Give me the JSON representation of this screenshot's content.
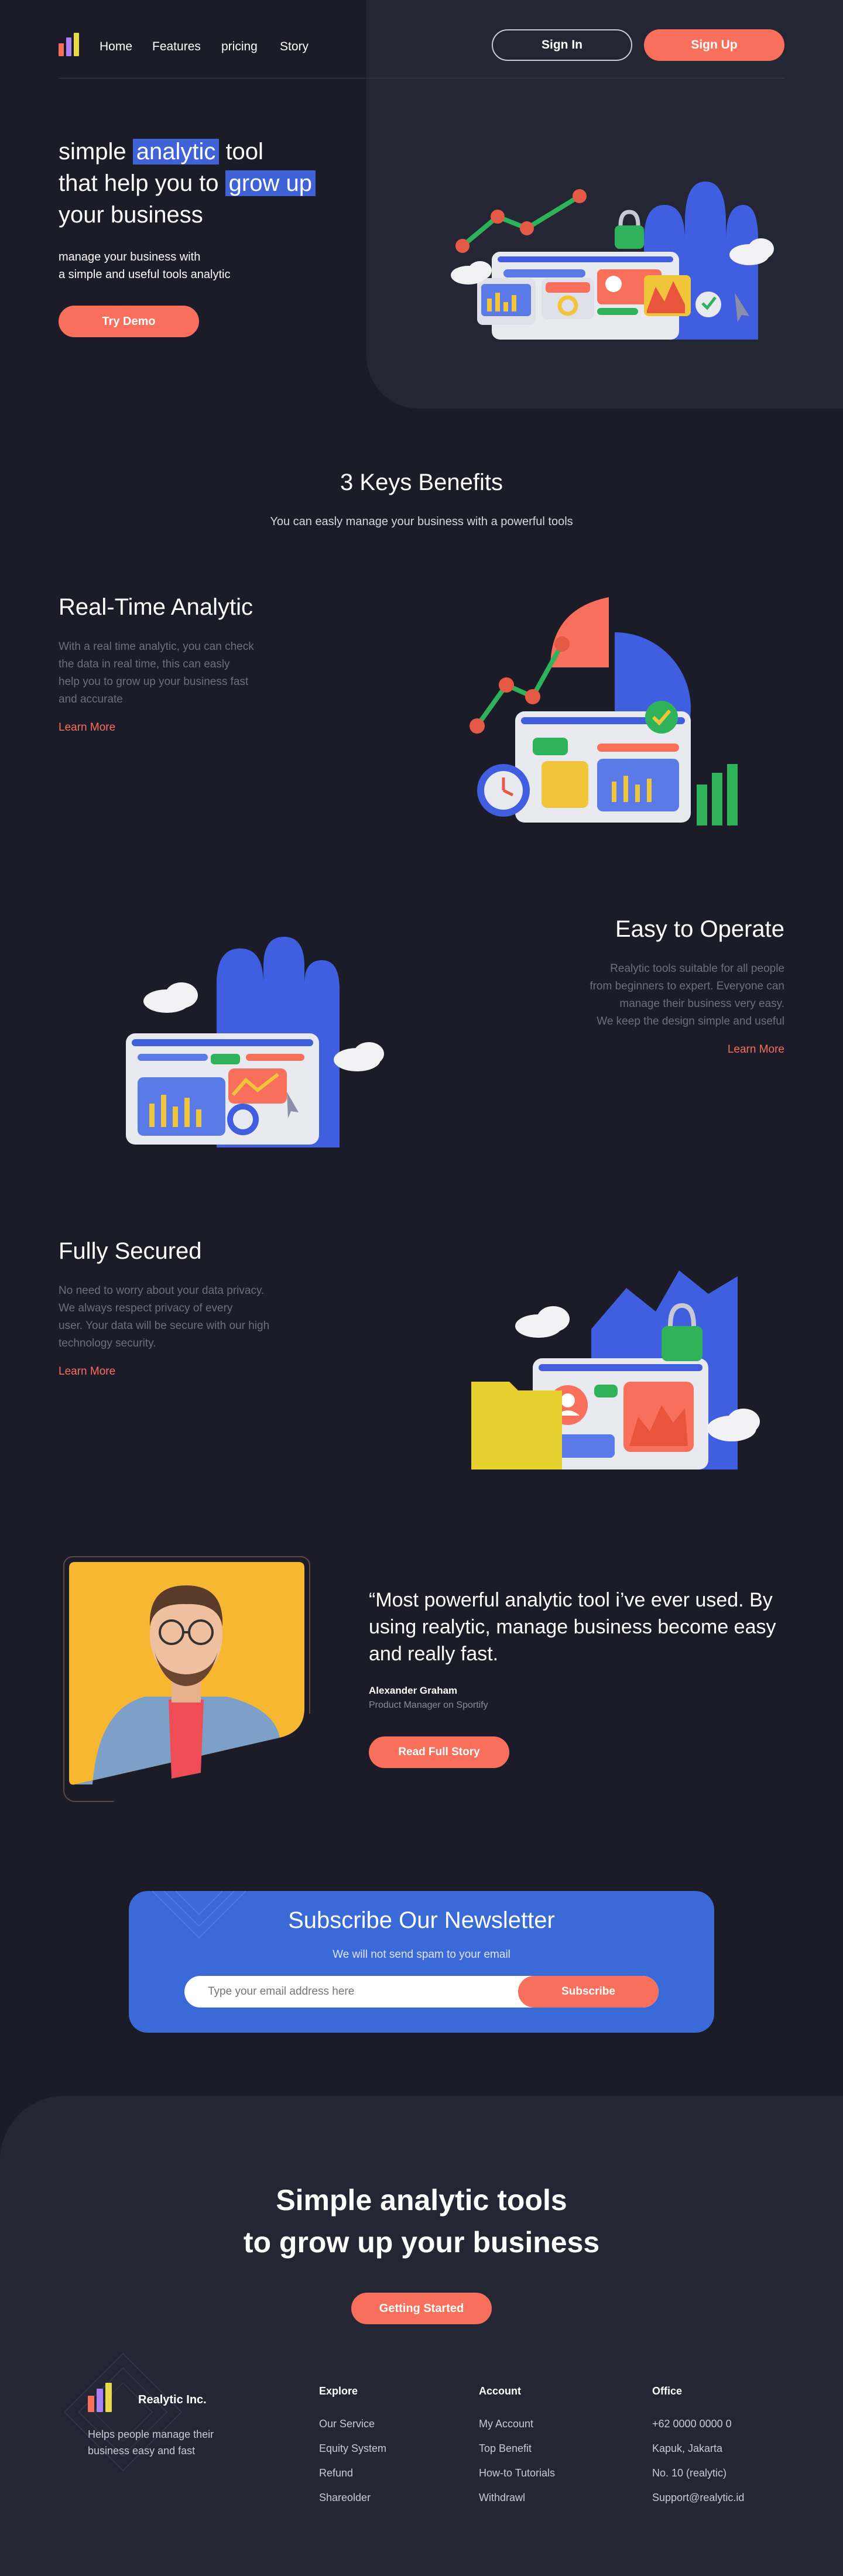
{
  "colors": {
    "background": "#1b1c27",
    "panel": "#242633",
    "accent": "#f86f5c",
    "brand_blue": "#3f63d6",
    "muted_text": "#6d6f7f"
  },
  "nav": {
    "items": [
      "Home",
      "Features",
      "pricing",
      "Story"
    ],
    "sign_in": "Sign In",
    "sign_up": "Sign Up"
  },
  "hero": {
    "title_parts": [
      "simple ",
      "analytic",
      " tool",
      "that help you to ",
      "grow up",
      "your business"
    ],
    "subtitle_line1": "manage your business with",
    "subtitle_line2": "a simple and useful tools analytic",
    "cta": "Try Demo"
  },
  "benefits": {
    "title": "3 Keys Benefits",
    "subtitle": "You can easly manage your business with a powerful tools",
    "items": [
      {
        "title": "Real-Time Analytic",
        "lines": [
          "With a real time analytic, you can check",
          "the data in real time, this can easly",
          "help you to grow up your business fast",
          "and accurate"
        ],
        "link": "Learn More"
      },
      {
        "title": "Easy to Operate",
        "lines": [
          "Realytic tools suitable for all people",
          "from beginners to expert. Everyone can",
          "manage their business very easy.",
          "We keep the design simple and useful"
        ],
        "link": "Learn More"
      },
      {
        "title": "Fully Secured",
        "lines": [
          "No need to worry about your data privacy.",
          "We always respect privacy of every",
          "user.  Your data will be secure with our high",
          "technology security."
        ],
        "link": "Learn More"
      }
    ]
  },
  "testimonial": {
    "quote": "“Most powerful analytic tool i’ve ever used. By using realytic, manage business become easy and really fast.",
    "name": "Alexander Graham",
    "role": "Product Manager on Sportify",
    "cta": "Read Full Story"
  },
  "newsletter": {
    "title": "Subscribe Our Newsletter",
    "subtitle": "We will not send spam to your email",
    "placeholder": "Type your email address here",
    "button": "Subscribe"
  },
  "cta_section": {
    "line1": "Simple analytic tools",
    "line2": "to grow up your business",
    "button": "Getting Started"
  },
  "footer": {
    "brand": "Realytic Inc.",
    "tagline_line1": "Helps people manage their",
    "tagline_line2": "business easy and fast",
    "columns": [
      {
        "title": "Explore",
        "links": [
          "Our Service",
          "Equity System",
          "Refund",
          "Shareolder"
        ]
      },
      {
        "title": "Account",
        "links": [
          "My Account",
          "Top Benefit",
          "How-to Tutorials",
          "Withdrawl"
        ]
      },
      {
        "title": "Office",
        "links": [
          "+62 0000 0000 0",
          "Kapuk, Jakarta",
          "No. 10 (realytic)",
          "Support@realytic.id"
        ]
      }
    ]
  }
}
